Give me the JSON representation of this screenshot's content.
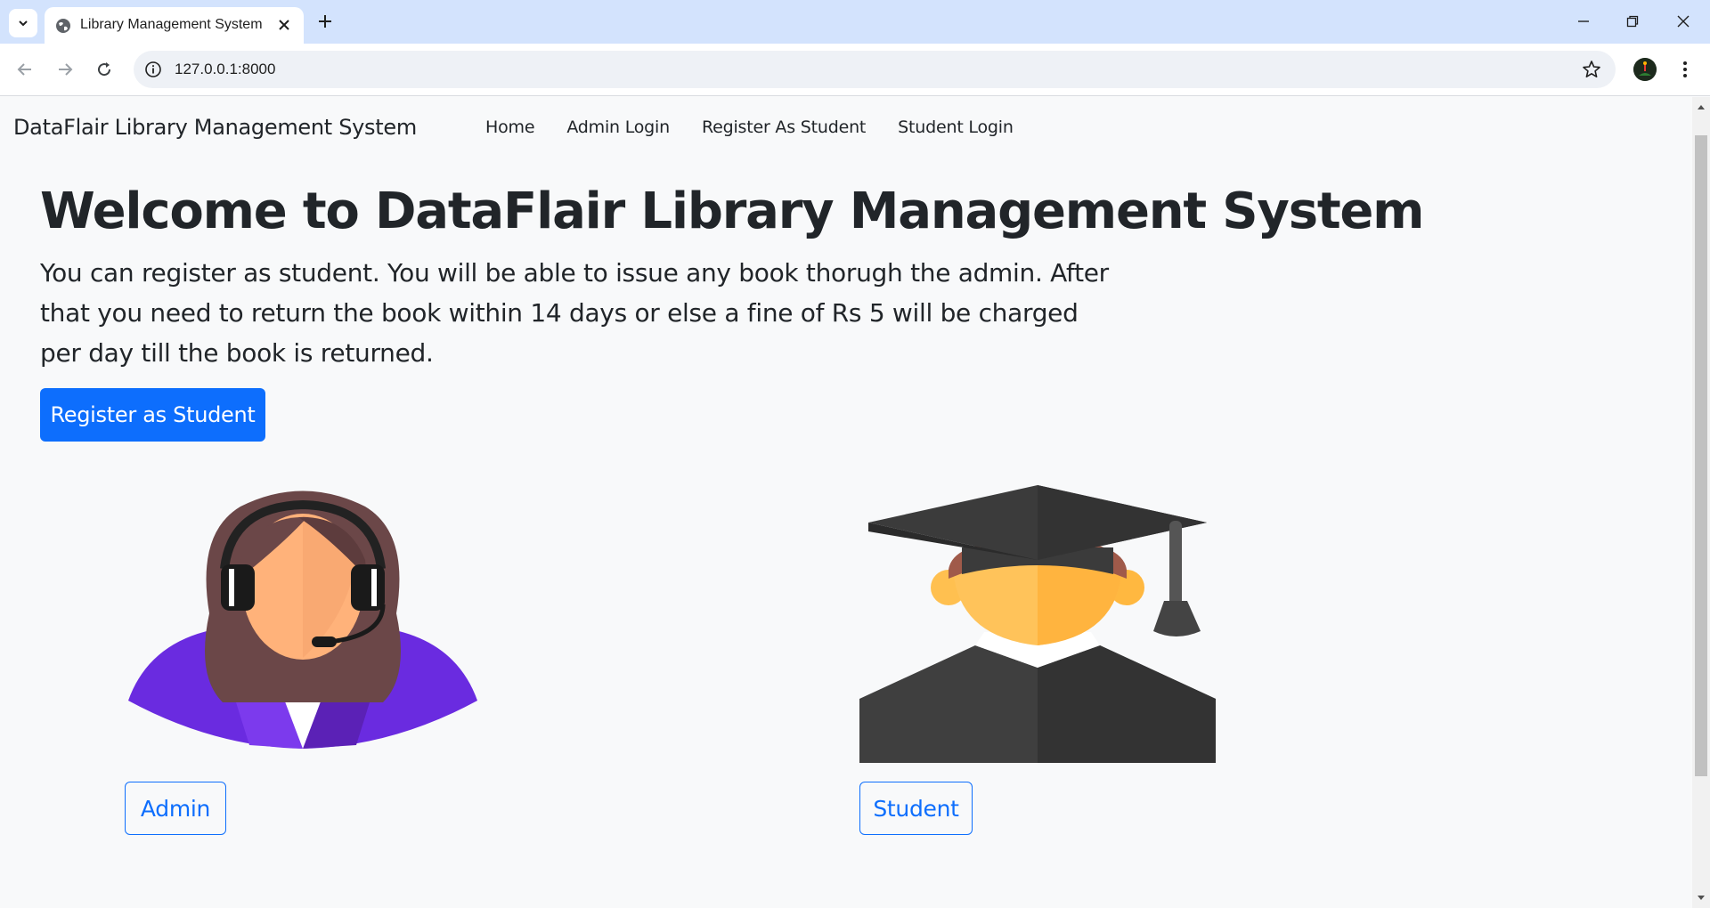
{
  "browser": {
    "tab_title": "Library Management System",
    "url": "127.0.0.1:8000"
  },
  "navbar": {
    "brand": "DataFlair Library Management System",
    "links": [
      "Home",
      "Admin Login",
      "Register As Student",
      "Student Login"
    ]
  },
  "hero": {
    "title": "Welcome to DataFlair Library Management System",
    "lead": "You can register as student. You will be able to issue any book thorugh the admin. After that you need to return the book within 14 days or else a fine of Rs 5 will be charged per day till the book is returned.",
    "register_button": "Register as Student"
  },
  "cards": {
    "admin_button": "Admin",
    "student_button": "Student"
  },
  "colors": {
    "primary": "#0d6efd",
    "page_bg": "#f8f9fa",
    "tabbar_bg": "#d3e3fd"
  }
}
